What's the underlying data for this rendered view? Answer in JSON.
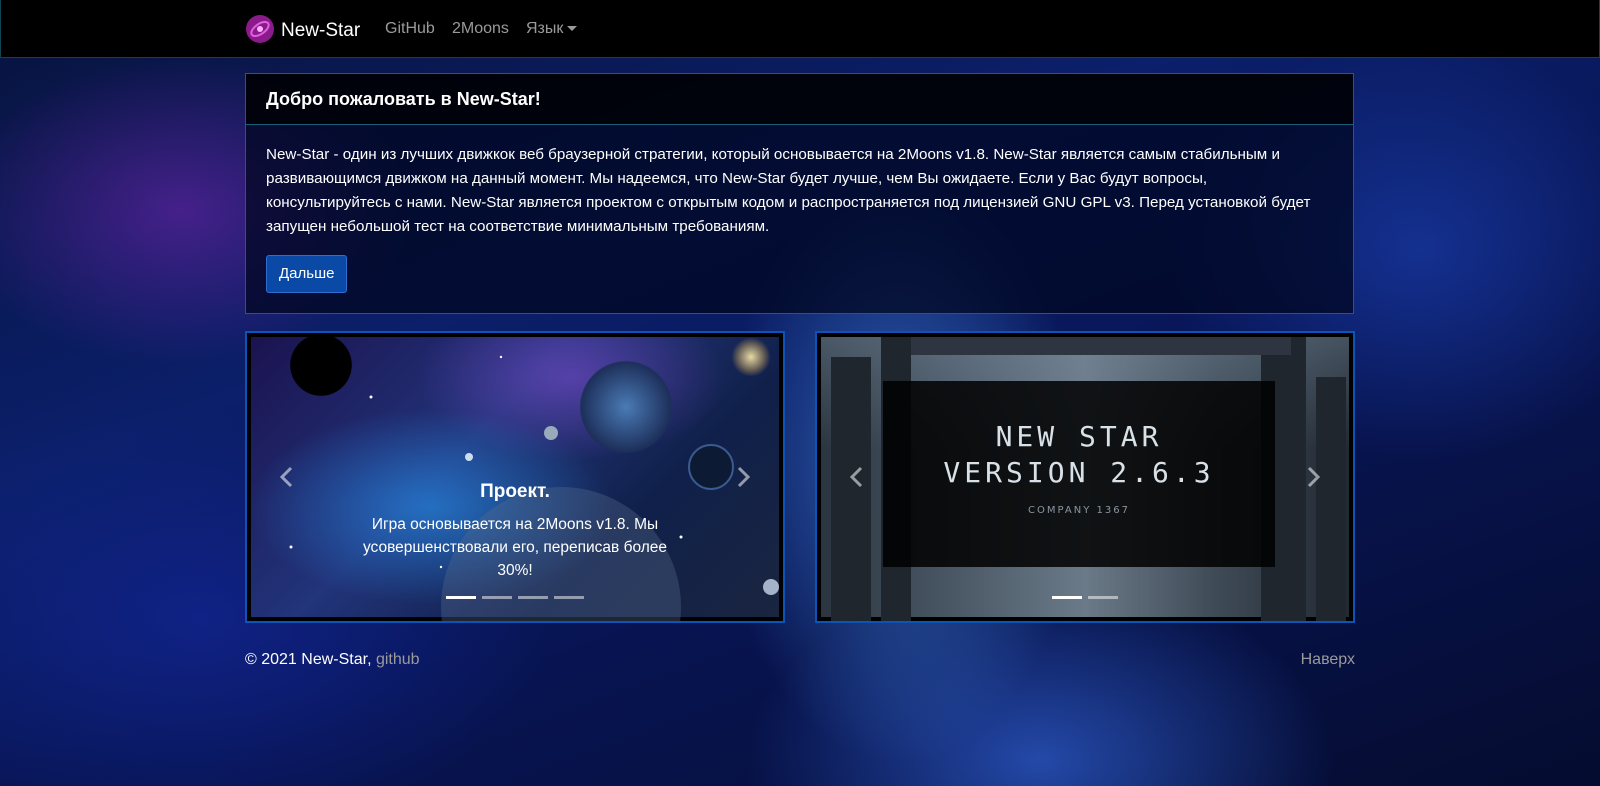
{
  "navbar": {
    "brand": "New-Star",
    "links": [
      "GitHub",
      "2Moons"
    ],
    "language_label": "Язык"
  },
  "welcome": {
    "title": "Добро пожаловать в New-Star!",
    "text": "New-Star - один из лучших движкок веб браузерной стратегии, который основывается на 2Moons v1.8. New-Star является самым стабильным и развивающимся движком на данный момент. Мы надеемся, что New-Star будет лучше, чем Вы ожидаете. Если у Вас будут вопросы, консультируйтесь с нами. New-Star является проектом с открытым кодом и распространяется под лицензией GNU GPL v3. Перед установкой будет запущен небольшой тест на соответствие минимальным требованиям.",
    "button": "Дальше"
  },
  "carousel1": {
    "caption_title": "Проект.",
    "caption_text": "Игра основывается на 2Moons v1.8. Мы усовершенствовали его, переписав более 30%!",
    "slide_count": 4,
    "active_index": 0
  },
  "carousel2": {
    "title_line1": "NEW STAR",
    "title_line2": "VERSION 2.6.3",
    "company": "COMPANY 1367",
    "slide_count": 2,
    "active_index": 0
  },
  "footer": {
    "copyright": "© 2021 New-Star,",
    "link": "github",
    "to_top": "Наверх"
  },
  "colors": {
    "navbar_bg": "#000000",
    "button_bg": "#0a4aa6",
    "carousel_border": "#0c54b8",
    "muted_text": "#9a9a9a"
  },
  "icons": {
    "brand": "galaxy-icon",
    "prev": "chevron-left-icon",
    "next": "chevron-right-icon"
  }
}
